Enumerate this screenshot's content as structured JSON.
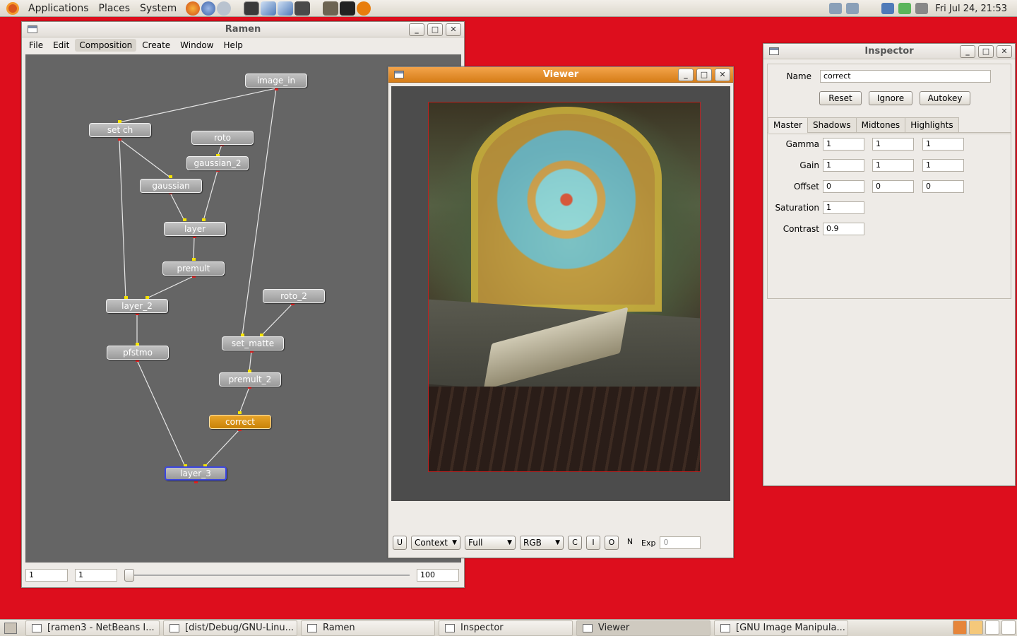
{
  "top_panel": {
    "menus": [
      "Applications",
      "Places",
      "System"
    ],
    "clock": "Fri Jul 24, 21:53"
  },
  "ramen": {
    "title": "Ramen",
    "menus": [
      "File",
      "Edit",
      "Composition",
      "Create",
      "Window",
      "Help"
    ],
    "selected_menu": "Composition",
    "nodes": {
      "image_in": "image_in",
      "set_ch": "set ch",
      "roto": "roto",
      "gaussian_2": "gaussian_2",
      "gaussian": "gaussian",
      "layer": "layer",
      "premult": "premult",
      "layer_2": "layer_2",
      "roto_2": "roto_2",
      "set_matte": "set_matte",
      "pfstmo": "pfstmo",
      "premult_2": "premult_2",
      "correct": "correct",
      "layer_3": "layer_3"
    },
    "selected_node": "correct",
    "output_node": "layer_3",
    "frame_start": "1",
    "frame_current": "1",
    "frame_end": "100",
    "slider_position": 0
  },
  "viewer": {
    "title": "Viewer",
    "u_label": "U",
    "context_select": "Context",
    "resolution_select": "Full",
    "channel_select": "RGB",
    "c_label": "C",
    "i_label": "I",
    "o_label": "O",
    "n_label": "N",
    "exp_label": "Exp",
    "exp_value": "0"
  },
  "inspector": {
    "title": "Inspector",
    "name_label": "Name",
    "name_value": "correct",
    "reset_label": "Reset",
    "ignore_label": "Ignore",
    "autokey_label": "Autokey",
    "tabs": [
      "Master",
      "Shadows",
      "Midtones",
      "Highlights"
    ],
    "active_tab": "Master",
    "params": {
      "gamma_label": "Gamma",
      "gamma": [
        "1",
        "1",
        "1"
      ],
      "gain_label": "Gain",
      "gain": [
        "1",
        "1",
        "1"
      ],
      "offset_label": "Offset",
      "offset": [
        "0",
        "0",
        "0"
      ],
      "saturation_label": "Saturation",
      "saturation": "1",
      "contrast_label": "Contrast",
      "contrast": "0.9"
    }
  },
  "taskbar": {
    "tasks": [
      "[ramen3 - NetBeans I...",
      "[dist/Debug/GNU-Linu...",
      "Ramen",
      "Inspector",
      "Viewer",
      "[GNU Image Manipula..."
    ],
    "active_task": "Viewer"
  },
  "colors": {
    "desktop": "#dd0e1d",
    "active_titlebar": "#e08a25",
    "selected_node": "#d99010",
    "output_node_border": "#3b46e0"
  }
}
